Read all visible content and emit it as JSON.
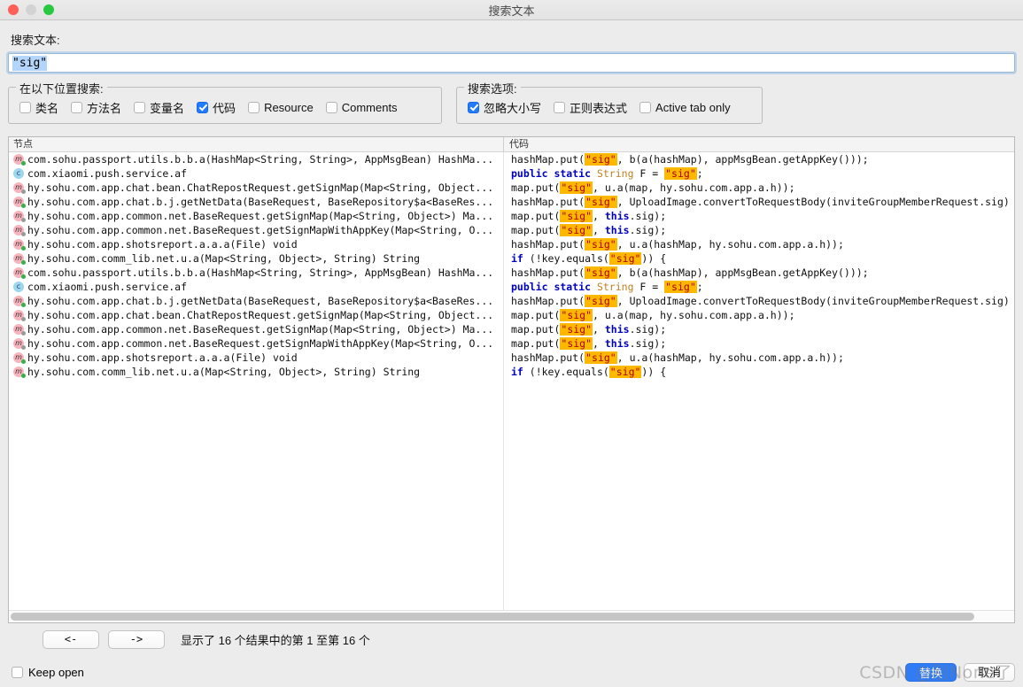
{
  "window": {
    "title": "搜索文本",
    "traffic_lights": [
      "close-red",
      "minimize-gray",
      "maximize-green"
    ]
  },
  "search": {
    "label": "搜索文本:",
    "value": "\"sig\"",
    "selected": true
  },
  "scope_group": {
    "legend": "在以下位置搜索:",
    "options": [
      {
        "label": "类名",
        "checked": false
      },
      {
        "label": "方法名",
        "checked": false
      },
      {
        "label": "变量名",
        "checked": false
      },
      {
        "label": "代码",
        "checked": true
      },
      {
        "label": "Resource",
        "checked": false
      },
      {
        "label": "Comments",
        "checked": false
      }
    ]
  },
  "options_group": {
    "legend": "搜索选项:",
    "options": [
      {
        "label": "忽略大小写",
        "checked": true
      },
      {
        "label": "正则表达式",
        "checked": false
      },
      {
        "label": "Active tab only",
        "checked": false
      }
    ]
  },
  "results": {
    "columns": {
      "node": "节点",
      "code": "代码"
    },
    "rows": [
      {
        "icon": "method-icon",
        "dot": "green",
        "node": "com.sohu.passport.utils.b.b.a(HashMap<String, String>, AppMsgBean) HashMa...",
        "code_html": "hashMap.put(<span class=\"hl\">\"sig\"</span>, b(a(hashMap), appMsgBean.getAppKey()));"
      },
      {
        "icon": "class-icon",
        "dot": "none",
        "node": "com.xiaomi.push.service.af",
        "code_html": "<span class=\"kw\">public static</span> <span class=\"typ\">String</span> F = <span class=\"hl\">\"sig\"</span>;"
      },
      {
        "icon": "method-icon",
        "dot": "gray",
        "node": "hy.sohu.com.app.chat.bean.ChatRepostRequest.getSignMap(Map<String, Object...",
        "code_html": "map.put(<span class=\"hl\">\"sig\"</span>, u.a(map, hy.sohu.com.app.a.h));"
      },
      {
        "icon": "method-icon",
        "dot": "green",
        "node": "hy.sohu.com.app.chat.b.j.getNetData(BaseRequest, BaseRepository$a<BaseRes...",
        "code_html": "hashMap.put(<span class=\"hl\">\"sig\"</span>, UploadImage.convertToRequestBody(inviteGroupMemberRequest.sig)"
      },
      {
        "icon": "method-icon",
        "dot": "gray",
        "node": "hy.sohu.com.app.common.net.BaseRequest.getSignMap(Map<String, Object>) Ma...",
        "code_html": "map.put(<span class=\"hl\">\"sig\"</span>, <span class=\"kw\">this</span>.sig);"
      },
      {
        "icon": "method-icon",
        "dot": "gray",
        "node": "hy.sohu.com.app.common.net.BaseRequest.getSignMapWithAppKey(Map<String, O...",
        "code_html": "map.put(<span class=\"hl\">\"sig\"</span>, <span class=\"kw\">this</span>.sig);"
      },
      {
        "icon": "method-icon",
        "dot": "green",
        "node": "hy.sohu.com.app.shotsreport.a.a.a(File) void",
        "code_html": "hashMap.put(<span class=\"hl\">\"sig\"</span>, u.a(hashMap, hy.sohu.com.app.a.h));"
      },
      {
        "icon": "method-icon",
        "dot": "green",
        "node": "hy.sohu.com.comm_lib.net.u.a(Map<String, Object>, String) String",
        "code_html": "<span class=\"kw\">if</span> (!key.equals(<span class=\"hl\">\"sig\"</span>)) {"
      },
      {
        "icon": "method-icon",
        "dot": "green",
        "node": "com.sohu.passport.utils.b.b.a(HashMap<String, String>, AppMsgBean) HashMa...",
        "code_html": "hashMap.put(<span class=\"hl\">\"sig\"</span>, b(a(hashMap), appMsgBean.getAppKey()));"
      },
      {
        "icon": "class-icon",
        "dot": "none",
        "node": "com.xiaomi.push.service.af",
        "code_html": "<span class=\"kw\">public static</span> <span class=\"typ\">String</span> F = <span class=\"hl\">\"sig\"</span>;"
      },
      {
        "icon": "method-icon",
        "dot": "green",
        "node": "hy.sohu.com.app.chat.b.j.getNetData(BaseRequest, BaseRepository$a<BaseRes...",
        "code_html": "hashMap.put(<span class=\"hl\">\"sig\"</span>, UploadImage.convertToRequestBody(inviteGroupMemberRequest.sig)"
      },
      {
        "icon": "method-icon",
        "dot": "gray",
        "node": "hy.sohu.com.app.chat.bean.ChatRepostRequest.getSignMap(Map<String, Object...",
        "code_html": "map.put(<span class=\"hl\">\"sig\"</span>, u.a(map, hy.sohu.com.app.a.h));"
      },
      {
        "icon": "method-icon",
        "dot": "gray",
        "node": "hy.sohu.com.app.common.net.BaseRequest.getSignMap(Map<String, Object>) Ma...",
        "code_html": "map.put(<span class=\"hl\">\"sig\"</span>, <span class=\"kw\">this</span>.sig);"
      },
      {
        "icon": "method-icon",
        "dot": "gray",
        "node": "hy.sohu.com.app.common.net.BaseRequest.getSignMapWithAppKey(Map<String, O...",
        "code_html": "map.put(<span class=\"hl\">\"sig\"</span>, <span class=\"kw\">this</span>.sig);"
      },
      {
        "icon": "method-icon",
        "dot": "green",
        "node": "hy.sohu.com.app.shotsreport.a.a.a(File) void",
        "code_html": "hashMap.put(<span class=\"hl\">\"sig\"</span>, u.a(hashMap, hy.sohu.com.app.a.h));"
      },
      {
        "icon": "method-icon",
        "dot": "green",
        "node": "hy.sohu.com.comm_lib.net.u.a(Map<String, Object>, String) String",
        "code_html": "<span class=\"kw\">if</span> (!key.equals(<span class=\"hl\">\"sig\"</span>)) {"
      }
    ]
  },
  "footer": {
    "prev_label": "<-",
    "next_label": "->",
    "status": "显示了 16 个结果中的第 1 至第 16 个",
    "keep_open": {
      "label": "Keep open",
      "checked": false
    },
    "primary_label": "替换",
    "secondary_label": "取消"
  },
  "watermark": "CSDN @别None了",
  "colors": {
    "accent": "#2f7cf6",
    "highlight": "#ffb800",
    "string": "#d40000",
    "keyword": "#0000c0",
    "type": "#c08020",
    "selection": "#b4d5fb"
  }
}
